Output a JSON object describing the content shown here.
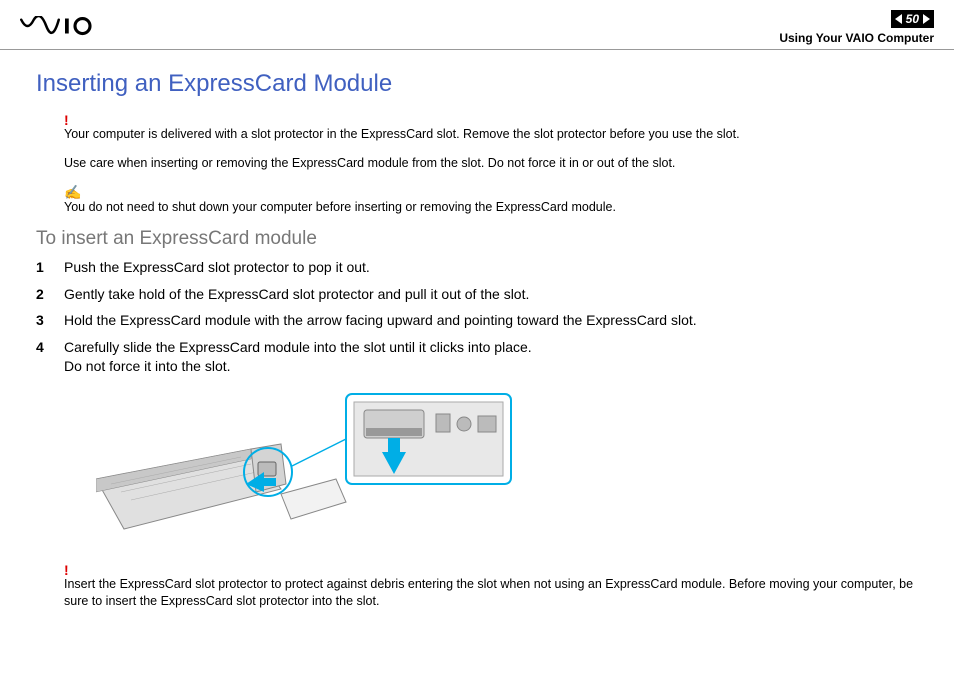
{
  "header": {
    "page_number": "50",
    "breadcrumb": "Using Your VAIO Computer"
  },
  "title": "Inserting an ExpressCard Module",
  "warnings": {
    "w1": "Your computer is delivered with a slot protector in the ExpressCard slot. Remove the slot protector before you use the slot.",
    "w2": "Use care when inserting or removing the ExpressCard module from the slot. Do not force it in or out of the slot."
  },
  "note": "You do not need to shut down your computer before inserting or removing the ExpressCard module.",
  "subhead": "To insert an ExpressCard module",
  "steps": {
    "s1": "Push the ExpressCard slot protector to pop it out.",
    "s2": "Gently take hold of the ExpressCard slot protector and pull it out of the slot.",
    "s3": "Hold the ExpressCard module with the arrow facing upward and pointing toward the ExpressCard slot.",
    "s4a": "Carefully slide the ExpressCard module into the slot until it clicks into place.",
    "s4b": "Do not force it into the slot."
  },
  "footer_warning": "Insert the ExpressCard slot protector to protect against debris entering the slot when not using an ExpressCard module. Before moving your computer, be sure to insert the ExpressCard slot protector into the slot."
}
